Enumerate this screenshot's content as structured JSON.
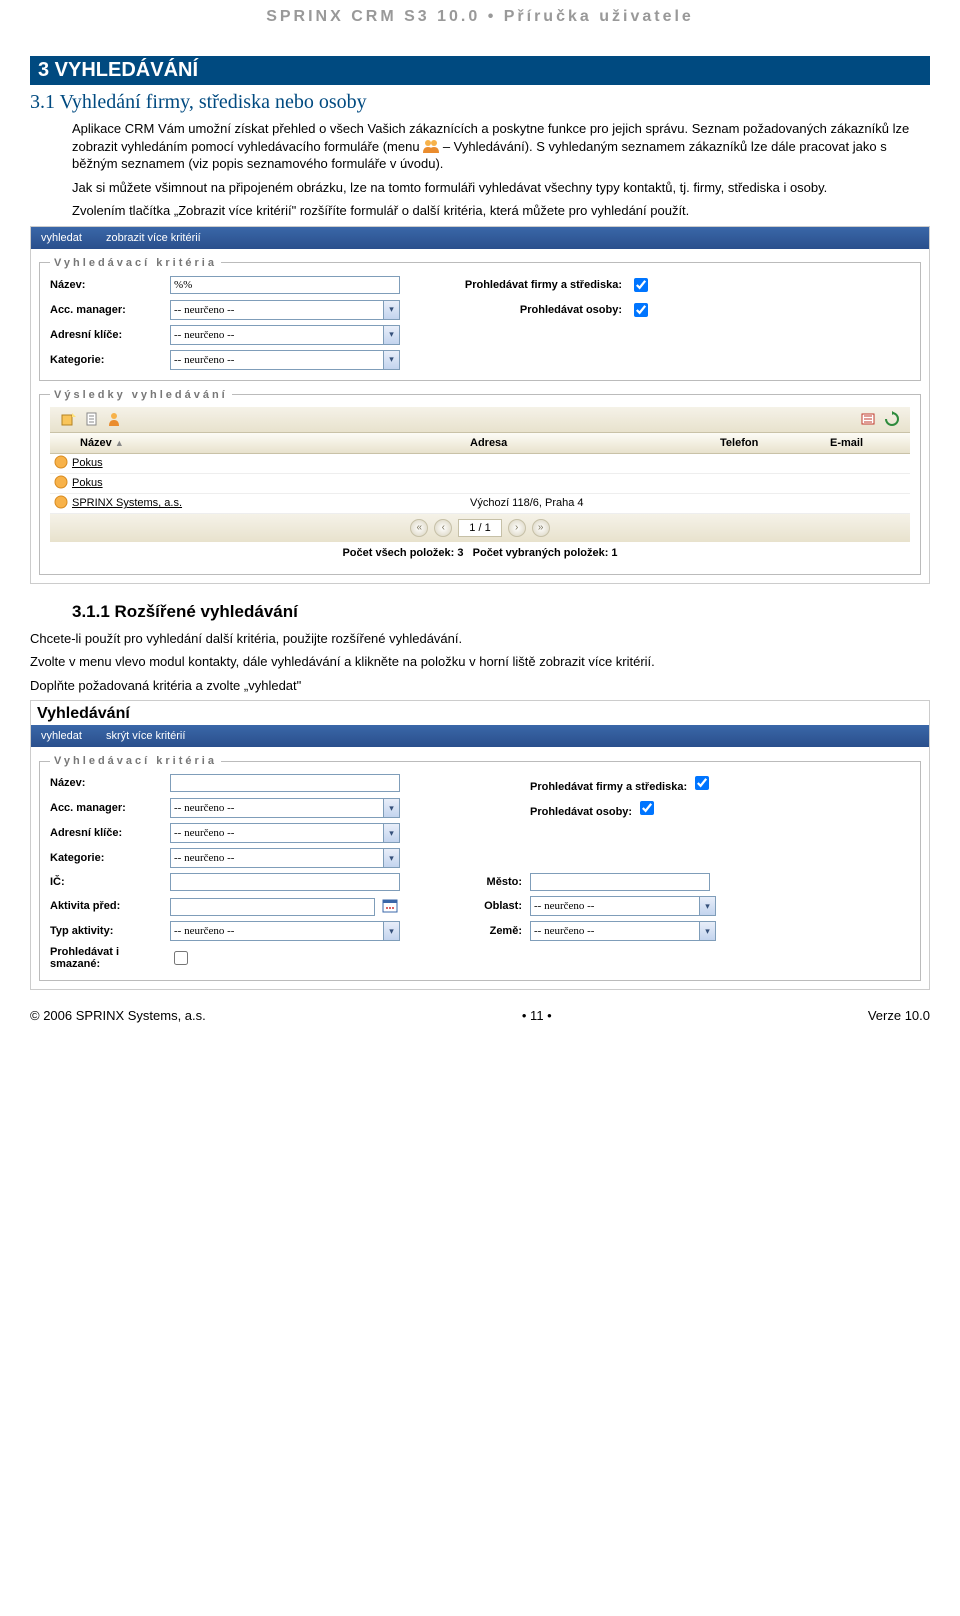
{
  "header": {
    "title": "SPRINX CRM S3 10.0 • Příručka uživatele"
  },
  "chapter": {
    "num_title": "3  VYHLEDÁVÁNÍ"
  },
  "sec31": {
    "title": "3.1 Vyhledání firmy, střediska nebo osoby",
    "p1": "Aplikace CRM Vám umožní získat přehled o všech Vašich zákaznících a poskytne funkce pro jejich správu. Seznam požadovaných zákazníků lze zobrazit vyhledáním pomocí vyhledávacího formuláře (menu",
    "p1b": " – Vyhledávání). S vyhledaným seznamem zákazníků lze dále pracovat jako s běžným seznamem (viz popis seznamového formuláře v úvodu).",
    "p2": "Jak si můžete všimnout na připojeném obrázku, lze na tomto formuláři vyhledávat všechny typy kontaktů, tj. firmy, střediska i osoby.",
    "p3": "Zvolením tlačítka „Zobrazit více kritérií\" rozšíříte formulář o další kritéria, která můžete pro vyhledání použít."
  },
  "shot1": {
    "menu": {
      "m1": "vyhledat",
      "m2": "zobrazit více kritérií"
    },
    "legend": "Vyhledávací kritéria",
    "fields": {
      "name_lbl": "Název:",
      "name_val": "%%",
      "acc_lbl": "Acc. manager:",
      "acc_val": "-- neurčeno --",
      "keys_lbl": "Adresní klíče:",
      "keys_val": "-- neurčeno --",
      "cat_lbl": "Kategorie:",
      "cat_val": "-- neurčeno --",
      "firmy_lbl": "Prohledávat firmy a střediska:",
      "osoby_lbl": "Prohledávat osoby:"
    },
    "results_legend": "Výsledky vyhledávání",
    "cols": {
      "name": "Název",
      "addr": "Adresa",
      "tel": "Telefon",
      "mail": "E-mail"
    },
    "rows": [
      {
        "name": "Pokus",
        "addr": ""
      },
      {
        "name": "Pokus",
        "addr": ""
      },
      {
        "name": "SPRINX Systems, a.s.",
        "addr": "Výchozí 118/6, Praha 4"
      }
    ],
    "pager": "1 / 1",
    "summary_a": "Počet všech položek: 3",
    "summary_b": "Počet vybraných položek: 1"
  },
  "sec311": {
    "title": "3.1.1  Rozšířené vyhledávání",
    "p1": "Chcete-li použít pro vyhledání další kritéria, použijte rozšířené vyhledávání.",
    "p2": "Zvolte v menu vlevo modul kontakty, dále vyhledávání a klikněte na položku v horní liště zobrazit více kritérií.",
    "p3": "Doplňte požadovaná kritéria a zvolte „vyhledat\""
  },
  "shot2": {
    "title": "Vyhledávání",
    "menu": {
      "m1": "vyhledat",
      "m2": "skrýt více kritérií"
    },
    "legend": "Vyhledávací kritéria",
    "fields": {
      "name_lbl": "Název:",
      "name_val": "",
      "acc_lbl": "Acc. manager:",
      "acc_val": "-- neurčeno --",
      "keys_lbl": "Adresní klíče:",
      "keys_val": "-- neurčeno --",
      "cat_lbl": "Kategorie:",
      "cat_val": "-- neurčeno --",
      "firmy_lbl": "Prohledávat firmy a střediska:",
      "osoby_lbl": "Prohledávat osoby:",
      "ic_lbl": "IČ:",
      "ic_val": "",
      "mesto_lbl": "Město:",
      "mesto_val": "",
      "act_lbl": "Aktivita před:",
      "act_val": "",
      "oblast_lbl": "Oblast:",
      "oblast_val": "-- neurčeno --",
      "typ_lbl": "Typ aktivity:",
      "typ_val": "-- neurčeno --",
      "zeme_lbl": "Země:",
      "zeme_val": "-- neurčeno --",
      "smaz_lbl": "Prohledávat i smazané:"
    }
  },
  "footer": {
    "left": "© 2006 SPRINX Systems, a.s.",
    "mid": "• 11 •",
    "right": "Verze 10.0"
  }
}
